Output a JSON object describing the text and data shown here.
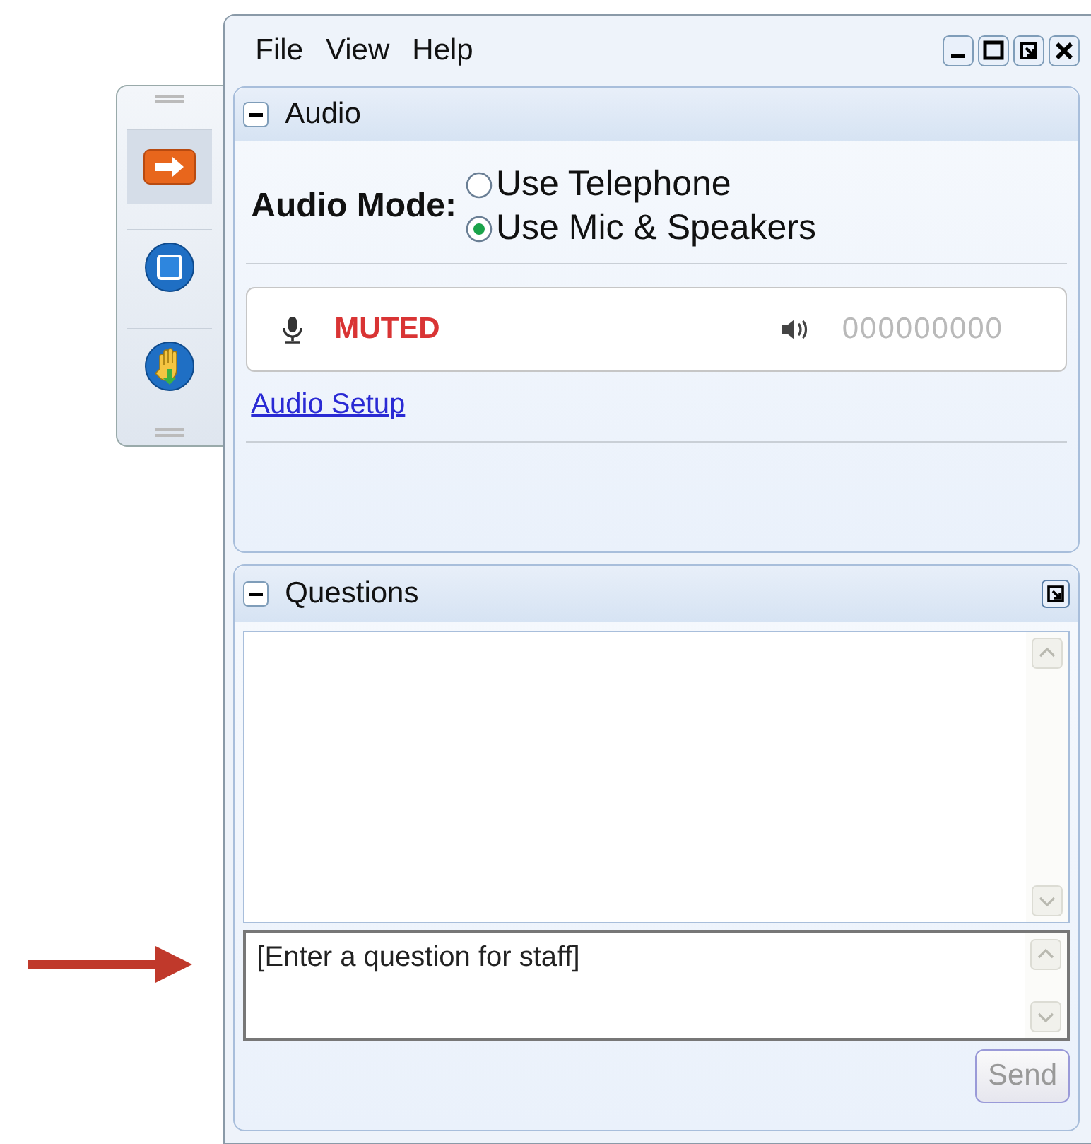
{
  "toolbar": {
    "items": [
      {
        "kind": "arrow",
        "selected": true
      },
      {
        "kind": "stop",
        "selected": false
      },
      {
        "kind": "hand",
        "selected": false
      }
    ]
  },
  "window": {
    "menu": [
      "File",
      "View",
      "Help"
    ],
    "controls": [
      {
        "kind": "minimize"
      },
      {
        "kind": "maximize"
      },
      {
        "kind": "restore"
      },
      {
        "kind": "close"
      }
    ]
  },
  "audio": {
    "title": "Audio",
    "mode_label": "Audio Mode:",
    "options": [
      {
        "label": "Use Telephone",
        "selected": false
      },
      {
        "label": "Use Mic & Speakers",
        "selected": true
      }
    ],
    "status": {
      "mic": "MUTED",
      "muted": true,
      "reading": "000000000"
    },
    "link": "Audio Setup"
  },
  "questions": {
    "title": "Questions",
    "input": {
      "placeholder": "[Enter a question for staff]"
    },
    "send_button": {
      "label": "Send",
      "disabled": true
    }
  }
}
